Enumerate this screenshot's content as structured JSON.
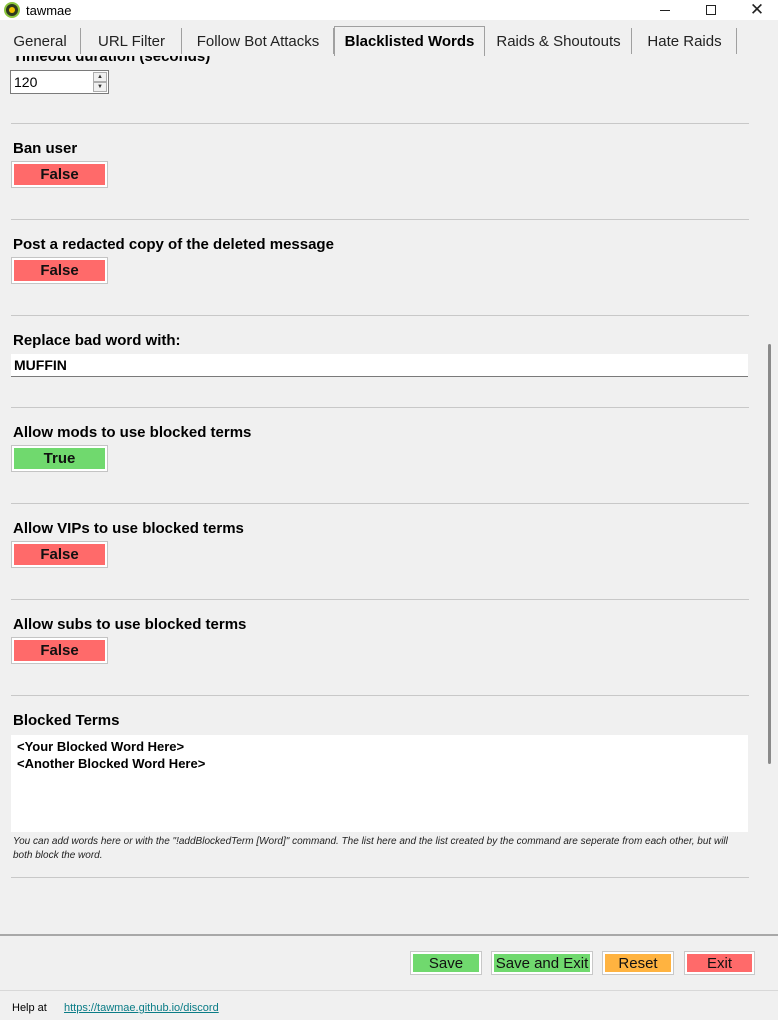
{
  "window": {
    "title": "tawmae",
    "app_icon": "tawmae-logo-icon",
    "minimize_icon": "minimize-icon",
    "maximize_icon": "maximize-icon",
    "close_icon": "close-icon",
    "close_glyph": "✕"
  },
  "tabs": [
    {
      "label": "General",
      "active": false
    },
    {
      "label": "URL Filter",
      "active": false
    },
    {
      "label": "Follow Bot Attacks",
      "active": false
    },
    {
      "label": "Blacklisted Words",
      "active": true
    },
    {
      "label": "Raids & Shoutouts",
      "active": false
    },
    {
      "label": "Hate Raids",
      "active": false
    }
  ],
  "settings": {
    "timeout": {
      "label": "Timeout duration (seconds)",
      "value": "120",
      "up_glyph": "▲",
      "down_glyph": "▼"
    },
    "ban_user": {
      "label": "Ban user",
      "value": "False"
    },
    "post_redacted": {
      "label": "Post a redacted copy of the deleted message",
      "value": "False"
    },
    "replace_word": {
      "label": "Replace bad word with:",
      "value": "MUFFIN"
    },
    "allow_mods": {
      "label": "Allow mods to use blocked terms",
      "value": "True"
    },
    "allow_vips": {
      "label": "Allow VIPs to use blocked terms",
      "value": "False"
    },
    "allow_subs": {
      "label": "Allow subs to use blocked terms",
      "value": "False"
    },
    "blocked_terms": {
      "label": "Blocked Terms",
      "lines": [
        "<Your Blocked Word Here>",
        "<Another Blocked Word Here>"
      ],
      "help": "You can add words here or with the \"!addBlockedTerm [Word]\" command. The list here and the list created by the command are seperate from each other, but will both block the word."
    }
  },
  "actions": {
    "save": "Save",
    "save_exit": "Save and Exit",
    "reset": "Reset",
    "exit": "Exit"
  },
  "footer": {
    "help_label": "Help at",
    "help_link": "https://tawmae.github.io/discord"
  },
  "colors": {
    "false_bg": "#ff6a6a",
    "true_bg": "#70d96e",
    "reset_bg": "#ffb340",
    "link": "#0a7c86"
  }
}
